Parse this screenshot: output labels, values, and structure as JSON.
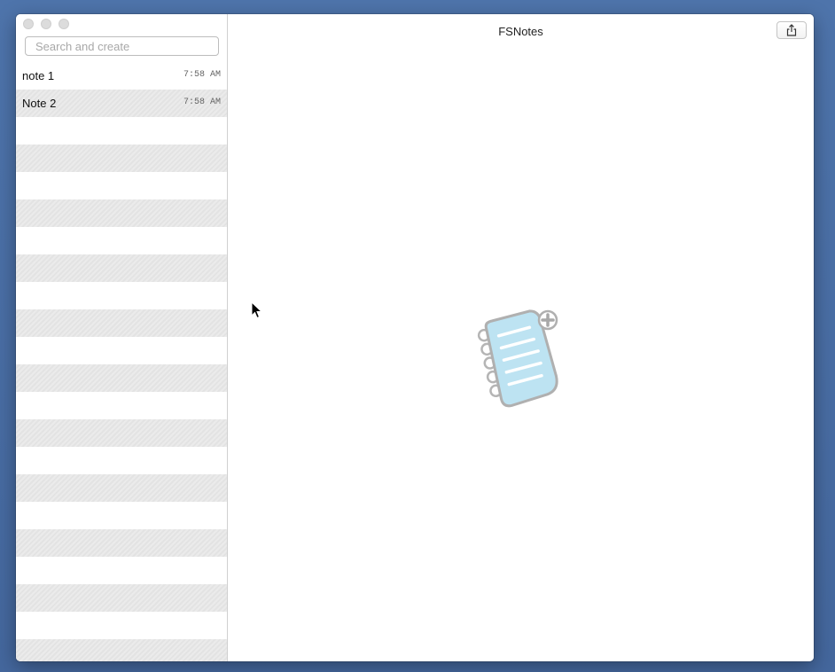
{
  "window": {
    "title": "FSNotes"
  },
  "search": {
    "placeholder": "Search and create",
    "value": ""
  },
  "notes": [
    {
      "title": "note 1",
      "time": "7:58 AM"
    },
    {
      "title": "Note 2",
      "time": "7:58 AM"
    }
  ],
  "icons": {
    "share": "share-icon",
    "empty_state": "new-note-illustration",
    "cursor": "mouse-pointer"
  },
  "colors": {
    "desktop": "#4a6fa5",
    "note_paper": "#bde3f2",
    "outline": "#b5b5b5",
    "stripe": "#e6e6e6"
  }
}
